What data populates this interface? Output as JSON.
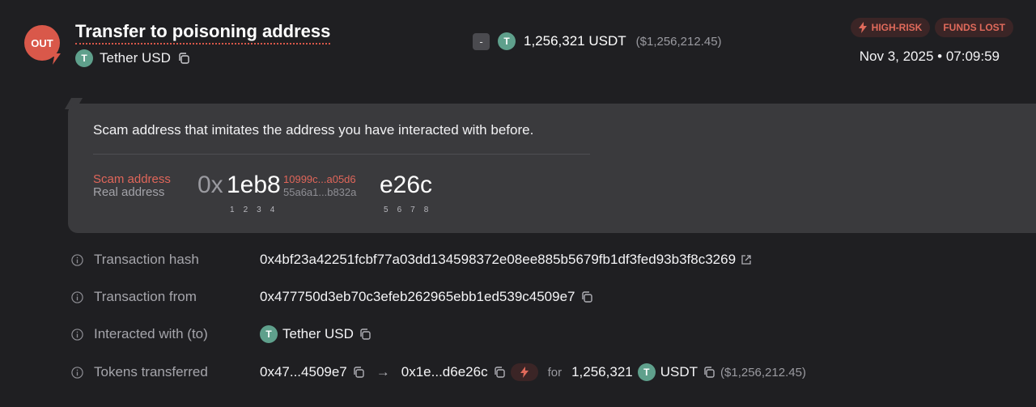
{
  "header": {
    "direction_badge": "OUT",
    "title": "Transfer to poisoning address",
    "token": {
      "logo_letter": "T",
      "name": "Tether USD"
    },
    "amount": {
      "sign": "-",
      "logo_letter": "T",
      "value": "1,256,321 USDT",
      "usd": "($1,256,212.45)"
    },
    "tags": [
      {
        "label": "HIGH-RISK",
        "icon": "bolt-icon"
      },
      {
        "label": "FUNDS LOST"
      }
    ],
    "datetime": "Nov 3, 2025 • 07:09:59"
  },
  "panel": {
    "description": "Scam address that imitates the address you have interacted with before.",
    "scam_label": "Scam address",
    "real_label": "Real address",
    "prefix": "0x",
    "first4": "1eb8",
    "scam_middle": "10999c...a05d6",
    "real_middle": "55a6a1...b832a",
    "last4": "e26c",
    "first_positions": [
      "1",
      "2",
      "3",
      "4"
    ],
    "last_positions": [
      "5",
      "6",
      "7",
      "8"
    ]
  },
  "details": {
    "hash": {
      "label": "Transaction hash",
      "value": "0x4bf23a42251fcbf77a03dd134598372e08ee885b5679fb1df3fed93b3f8c3269"
    },
    "from": {
      "label": "Transaction from",
      "value": "0x477750d3eb70c3efeb262965ebb1ed539c4509e7"
    },
    "to": {
      "label": "Interacted with (to)",
      "logo_letter": "T",
      "value": "Tether USD"
    },
    "tokens": {
      "label": "Tokens transferred",
      "from": "0x47...4509e7",
      "arrow": "→",
      "to": "0x1e...d6e26c",
      "for": "for",
      "amount": "1,256,321",
      "logo_letter": "T",
      "symbol": "USDT",
      "usd": "($1,256,212.45)"
    }
  },
  "colors": {
    "accent_red": "#d9584a",
    "tether_green": "#5fa08c",
    "background": "#1f1f22",
    "panel": "#3a3a3d"
  }
}
